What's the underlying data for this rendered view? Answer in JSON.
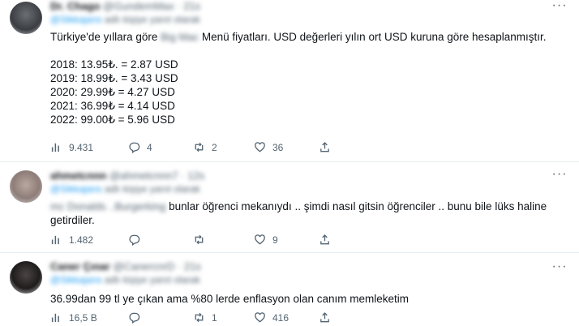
{
  "tweets": [
    {
      "display_name": "Dr. Chago",
      "handle": "@GundemMax · 21s",
      "replying_to_prefix": "@",
      "replying_to": "Sikkajans",
      "replying_suffix": " adlı kişiye yanıt olarak",
      "text_before": "Türkiye'de yıllara göre ",
      "text_blur": "Big Mac",
      "text_after": " Menü fiyatları. USD değerleri yılın ort USD kuruna göre hesaplanmıştır.",
      "prices": [
        "2018: 13.95₺. = 2.87 USD",
        "2019: 18.99₺. = 3.43 USD",
        "2020: 29.99₺ = 4.27 USD",
        "2021: 36.99₺ = 4.14 USD",
        "2022: 99.00₺ = 5.96 USD"
      ],
      "stats": {
        "views": "9.431",
        "replies": "4",
        "retweets": "2",
        "likes": "36"
      }
    },
    {
      "display_name": "ahmetcnnn",
      "handle": "@ahmetcnnn7 · 12s",
      "replying_to_prefix": "@",
      "replying_to": "Sikkajans",
      "replying_suffix": " adlı kişiye yanıt olarak",
      "text_blur": "mc Donalds .. ",
      "text_blur2": "Burgerking",
      "text_after": " bunlar öğrenci mekanıydı .. şimdi nasıl gitsin öğrenciler .. bunu bile lüks haline getirdiler.",
      "stats": {
        "views": "1.482",
        "replies": "",
        "retweets": "",
        "likes": "9"
      }
    },
    {
      "display_name": "Caner Çınar",
      "handle": "@CanercnrD · 21s",
      "replying_to_prefix": "@",
      "replying_to": "Sikkajans",
      "replying_suffix": " adlı kişiye yanıt olarak",
      "text_after": "36.99dan 99 tl ye çıkan ama %80 lerde enflasyon olan canım memleketim",
      "stats": {
        "views": "16,5 B",
        "replies": "",
        "retweets": "1",
        "likes": "416"
      }
    }
  ],
  "more_label": "···",
  "icons": [
    "views-icon",
    "reply-icon",
    "retweet-icon",
    "like-icon",
    "share-icon",
    "more-icon"
  ],
  "colors": {
    "secondary_text": "#536471",
    "link": "#1d9bf0",
    "divider": "#e6ecf0"
  }
}
